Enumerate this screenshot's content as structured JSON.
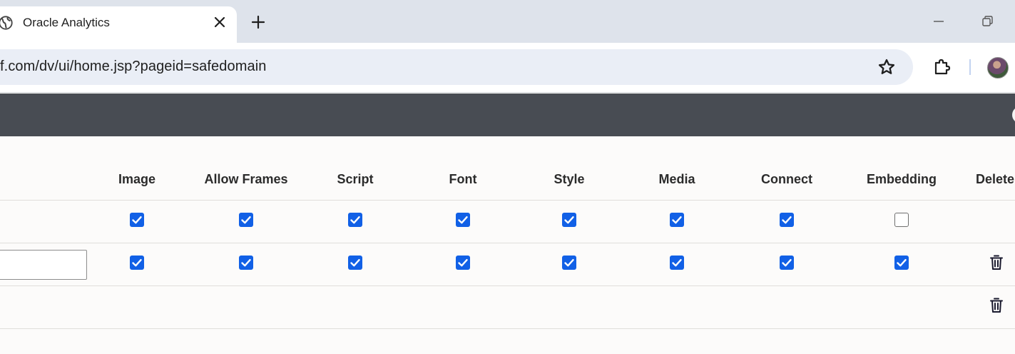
{
  "browser": {
    "tab": {
      "title": "Oracle Analytics",
      "icon": "globe-icon"
    },
    "url": "f.com/dv/ui/home.jsp?pageid=safedomain"
  },
  "table": {
    "headers": [
      "Image",
      "Allow Frames",
      "Script",
      "Font",
      "Style",
      "Media",
      "Connect",
      "Embedding",
      "Delete"
    ],
    "rows": [
      {
        "checks": [
          true,
          true,
          true,
          true,
          true,
          true,
          true,
          false
        ],
        "domain_value": null,
        "delete": false
      },
      {
        "checks": [
          true,
          true,
          true,
          true,
          true,
          true,
          true,
          true
        ],
        "domain_value": "",
        "delete": true
      },
      {
        "checks": [],
        "domain_value": null,
        "delete": true
      }
    ]
  },
  "colors": {
    "accent": "#1160e6",
    "appbar": "#484c53",
    "tabstrip": "#dee3eb"
  }
}
